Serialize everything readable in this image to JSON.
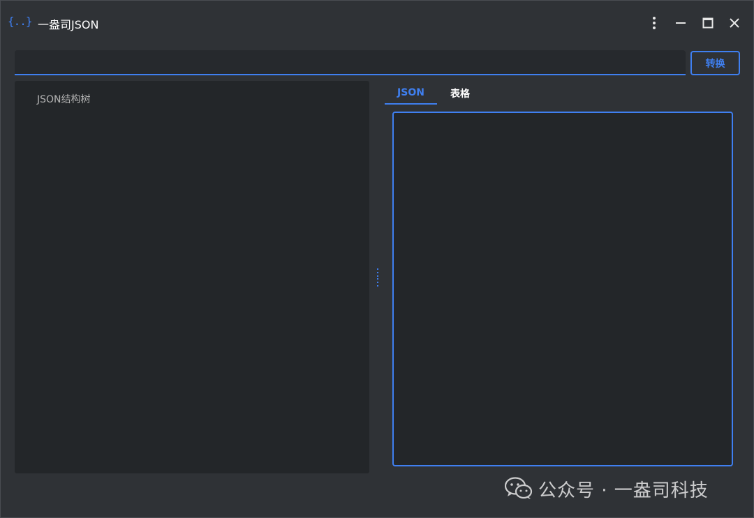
{
  "app": {
    "logo_text": "{..}",
    "title": "一盎司JSON"
  },
  "window_controls": {
    "more": "more-vert-icon",
    "minimize": "minimize-icon",
    "maximize": "maximize-icon",
    "close": "close-icon"
  },
  "input_bar": {
    "value": "",
    "placeholder": ""
  },
  "convert_button": {
    "label": "转换"
  },
  "tree_panel": {
    "label": "JSON结构树"
  },
  "tabs": [
    {
      "label": "JSON",
      "active": true
    },
    {
      "label": "表格",
      "active": false
    }
  ],
  "json_editor": {
    "value": ""
  },
  "watermark": {
    "text": "公众号 · 一盎司科技",
    "icon": "wechat-icon"
  },
  "colors": {
    "background": "#2f3236",
    "panel": "#232629",
    "accent": "#3f7ff0",
    "text": "#ffffff",
    "muted_text": "#b4b4b4"
  }
}
